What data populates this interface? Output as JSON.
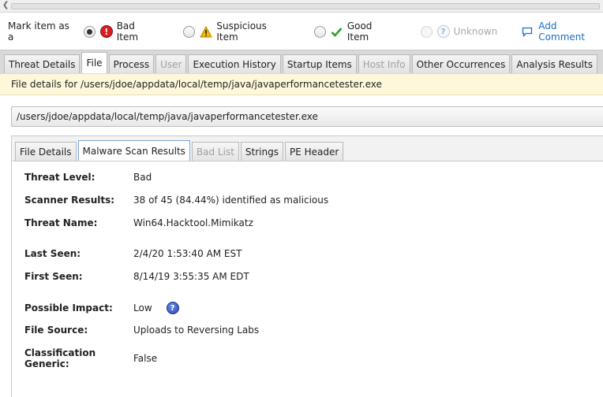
{
  "mark_item": {
    "label": "Mark item as a",
    "options": [
      {
        "label": "Bad Item",
        "selected": true,
        "icon": "error-icon"
      },
      {
        "label": "Suspicious Item",
        "selected": false,
        "icon": "warning-icon"
      },
      {
        "label": "Good Item",
        "selected": false,
        "icon": "checkmark-icon"
      },
      {
        "label": "Unknown",
        "selected": false,
        "disabled": true,
        "icon": "question-icon"
      }
    ],
    "add_comment": "Add Comment"
  },
  "main_tabs": [
    {
      "label": "Threat Details",
      "active": false
    },
    {
      "label": "File",
      "active": true
    },
    {
      "label": "Process",
      "active": false
    },
    {
      "label": "User",
      "disabled": true
    },
    {
      "label": "Execution History",
      "active": false
    },
    {
      "label": "Startup Items",
      "active": false
    },
    {
      "label": "Host Info",
      "disabled": true
    },
    {
      "label": "Other Occurrences",
      "active": false
    },
    {
      "label": "Analysis Results",
      "active": false
    }
  ],
  "file_banner": "File details for /users/jdoe/appdata/local/temp/java/javaperformancetester.exe",
  "path_field": "/users/jdoe/appdata/local/temp/java/javaperformancetester.exe",
  "inner_tabs": [
    {
      "label": "File Details",
      "active": false
    },
    {
      "label": "Malware Scan Results",
      "active": true
    },
    {
      "label": "Bad List",
      "disabled": true
    },
    {
      "label": "Strings",
      "active": false
    },
    {
      "label": "PE Header",
      "active": false
    }
  ],
  "scan_results": {
    "threat_level": {
      "label": "Threat Level:",
      "value": "Bad"
    },
    "scanner_results": {
      "label": "Scanner Results:",
      "value": "38 of 45 (84.44%) identified as malicious"
    },
    "threat_name": {
      "label": "Threat Name:",
      "value": "Win64.Hacktool.Mimikatz"
    },
    "last_seen": {
      "label": "Last Seen:",
      "value": "2/4/20 1:53:40 AM EST"
    },
    "first_seen": {
      "label": "First Seen:",
      "value": "8/14/19 3:55:35 AM EDT"
    },
    "possible_impact": {
      "label": "Possible Impact:",
      "value": "Low"
    },
    "file_source": {
      "label": "File Source:",
      "value": "Uploads to Reversing Labs"
    },
    "classification_generic": {
      "label": "Classification Generic:",
      "value": "False"
    }
  },
  "colors": {
    "bad": "#d81e1e",
    "warning": "#f2b705",
    "good": "#2aa02a",
    "link": "#1a6fc4",
    "banner": "#fef8da"
  }
}
